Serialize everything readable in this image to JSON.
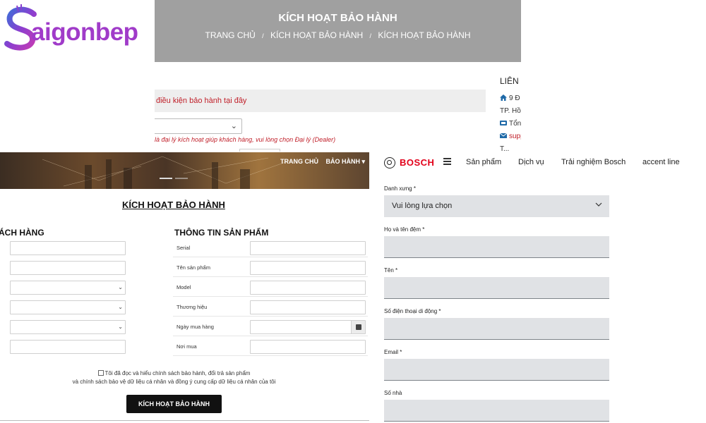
{
  "logo": {
    "text": "aigonbep"
  },
  "panel1": {
    "title": "KÍCH HOẠT BẢO HÀNH",
    "breadcrumbs": [
      "TRANG CHỦ",
      "KÍCH HOẠT BẢO HÀNH",
      "KÍCH HOẠT BẢO HÀNH"
    ],
    "separator": "/",
    "warranty_link": "điều kiện bảo hành tại đây",
    "dealer_note": "là đại lý kích hoạt giúp khách hàng, vui lòng chọn Đại lý (Dealer)",
    "contact": {
      "heading": "LIÊN",
      "lines": [
        "9 Đ",
        "TP. Hồ",
        "Tổn",
        "supp",
        "T..."
      ]
    }
  },
  "panel2": {
    "nav": [
      "TRANG CHỦ",
      "BẢO HÀNH ▾"
    ],
    "title": "KÍCH HOẠT BẢO HÀNH",
    "section_customer": "ÁCH HÀNG",
    "section_product": "THÔNG TIN SẢN PHẨM",
    "product_fields": [
      "Serial",
      "Tên sản phẩm",
      "Model",
      "Thương hiệu",
      "Ngày mua hàng",
      "Nơi mua"
    ],
    "consent_line1": "Tôi đã đọc và hiểu chính sách bảo hành, đổi trả sản phẩm",
    "consent_line2": "và chính sách bảo vệ dữ liệu cá nhân và đồng ý cung cấp dữ liệu cá nhân của tôi",
    "submit_label": "KÍCH HOẠT BẢO HÀNH"
  },
  "panel3": {
    "brand": "BOSCH",
    "nav": [
      "Sản phẩm",
      "Dịch vụ",
      "Trải nghiệm Bosch",
      "accent line"
    ],
    "fields": [
      {
        "label": "Danh xưng *",
        "type": "select",
        "value": "Vui lòng lựa chọn"
      },
      {
        "label": "Họ và tên đệm *",
        "type": "text",
        "value": ""
      },
      {
        "label": "Tên *",
        "type": "text",
        "value": ""
      },
      {
        "label": "Số điện thoại di động *",
        "type": "text",
        "value": ""
      },
      {
        "label": "Email *",
        "type": "text",
        "value": ""
      },
      {
        "label": "Số nhà",
        "type": "text",
        "value": ""
      }
    ]
  },
  "colors": {
    "banner": "#a0a0a0",
    "red": "#c0202a",
    "bosch_red": "#e2001a",
    "logo_purple": "#a03bc9"
  }
}
